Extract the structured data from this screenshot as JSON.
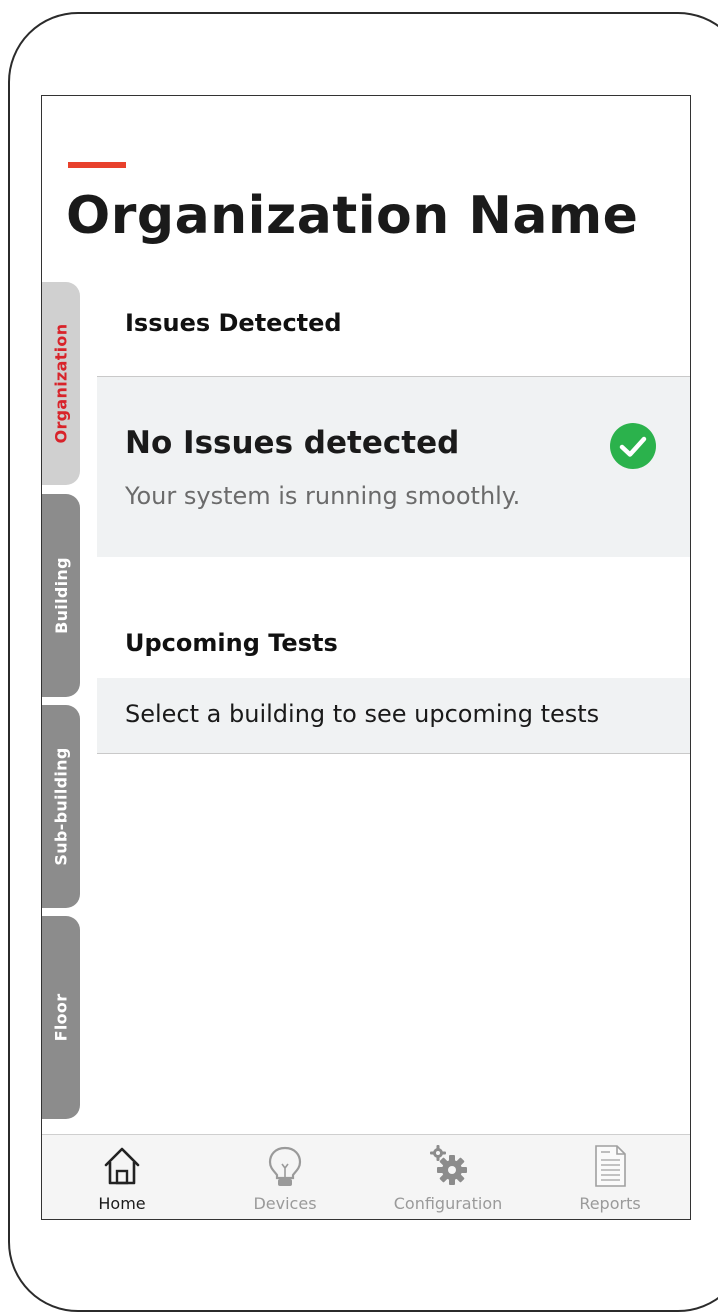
{
  "header": {
    "title": "Organization Name"
  },
  "side_tabs": [
    {
      "label": "Organization",
      "active": true
    },
    {
      "label": "Building",
      "active": false
    },
    {
      "label": "Sub-building",
      "active": false
    },
    {
      "label": "Floor",
      "active": false
    }
  ],
  "issues": {
    "section_title": "Issues Detected",
    "status_title": "No Issues detected",
    "status_message": "Your system is running smoothly.",
    "status_icon": "check-circle-icon",
    "status_color": "#2bb24c"
  },
  "tests": {
    "section_title": "Upcoming Tests",
    "message": "Select a building to see upcoming tests"
  },
  "bottom_nav": [
    {
      "label": "Home",
      "icon": "home-icon",
      "active": true
    },
    {
      "label": "Devices",
      "icon": "lightbulb-icon",
      "active": false
    },
    {
      "label": "Configuration",
      "icon": "gears-icon",
      "active": false
    },
    {
      "label": "Reports",
      "icon": "document-icon",
      "active": false
    }
  ],
  "colors": {
    "accent": "#e8412c",
    "active_tab_text": "#d8232a",
    "inactive_tab": "#8c8c8c",
    "card_background": "#f0f2f3"
  }
}
